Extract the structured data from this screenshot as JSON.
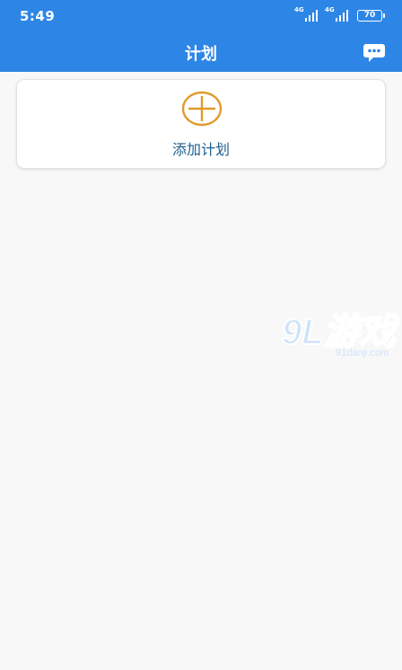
{
  "status_bar": {
    "time": "5:49",
    "signal_1": "4G",
    "signal_2": "4G",
    "battery": "70"
  },
  "header": {
    "title": "计划",
    "chat_icon": "chat-bubble-icon"
  },
  "plan_card": {
    "icon": "add-circle-icon",
    "label": "添加计划",
    "accent_color": "#e09a2c"
  },
  "watermark": {
    "brand": "9L游戏",
    "url": "91danji.com"
  },
  "colors": {
    "header_bg": "#2d86e6",
    "page_bg": "#f8f8f8",
    "label_text": "#1f5f8f"
  }
}
